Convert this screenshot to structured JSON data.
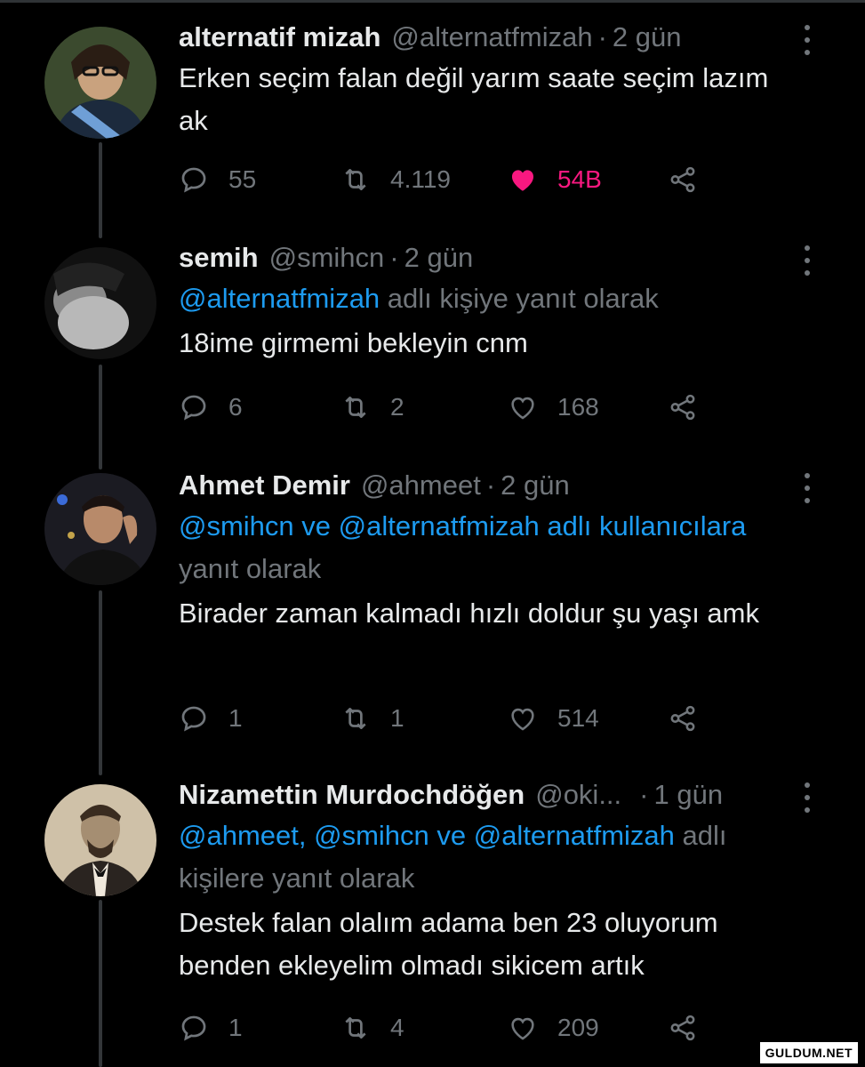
{
  "colors": {
    "background": "#000000",
    "text": "#e7e9ea",
    "muted": "#71767b",
    "mention": "#1d9bf0",
    "like_active": "#f91880"
  },
  "icons": {
    "reply": "comment-bubble-icon",
    "retweet": "retweet-icon",
    "like": "heart-icon",
    "share": "share-icon",
    "more": "more-vertical-icon"
  },
  "tweets": [
    {
      "name": "alternatif mizah",
      "handle": "@alternatfmizah",
      "time": "2 gün",
      "text": "Erken seçim falan değil yarım saate seçim lazım ak",
      "replies": "55",
      "retweets": "4.119",
      "likes": "54B",
      "liked": true
    },
    {
      "name": "semih",
      "handle": "@smihcn",
      "time": "2 gün",
      "reply_mention": "@alternatfmizah",
      "reply_suffix": " adlı kişiye yanıt olarak",
      "text": "18ime girmemi bekleyin cnm",
      "replies": "6",
      "retweets": "2",
      "likes": "168"
    },
    {
      "name": "Ahmet Demir",
      "handle": "@ahmeet",
      "time": "2 gün",
      "reply_mention": "@smihcn ve @alternatfmizah adlı kullanıcılara",
      "reply_suffix": " yanıt olarak",
      "text": "Birader zaman kalmadı hızlı doldur şu yaşı amk",
      "replies": "1",
      "retweets": "1",
      "likes": "514"
    },
    {
      "name": "Nizamettin Murdochdöğen",
      "handle": "@oki...",
      "time": "1 gün",
      "reply_mention": "@ahmeet, @smihcn ve @alternatfmizah",
      "reply_suffix": " adlı kişilere yanıt olarak",
      "text": "Destek falan olalım adama ben 23 oluyorum benden ekleyelim olmadı sikicem artık",
      "replies": "1",
      "retweets": "4",
      "likes": "209"
    }
  ],
  "watermark": "GULDUM.NET"
}
